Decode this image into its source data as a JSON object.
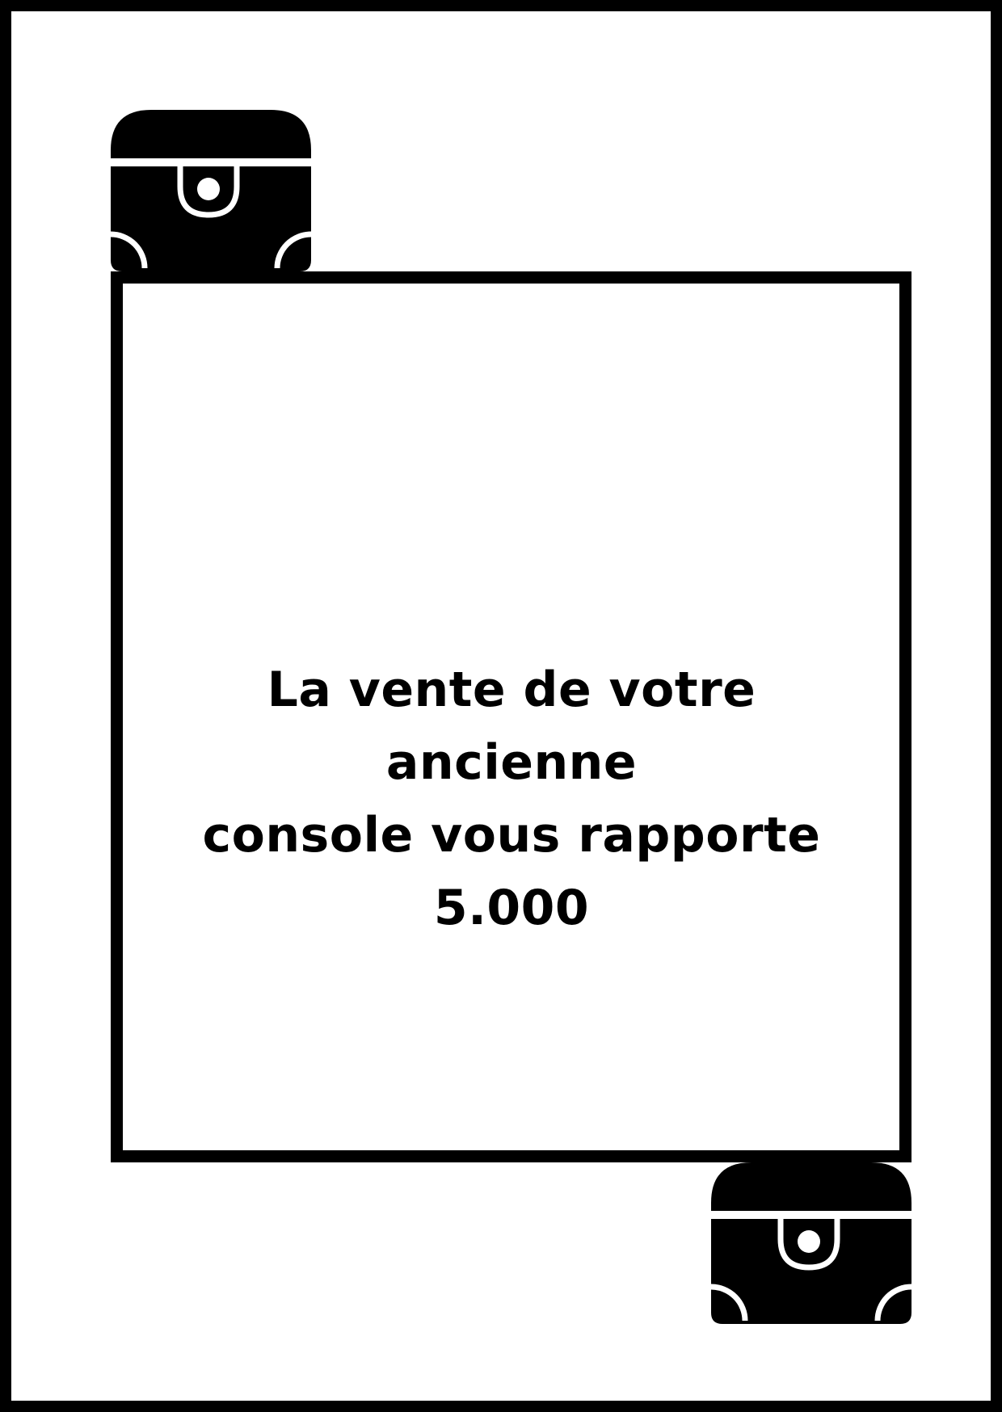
{
  "card": {
    "message_line_1": "La vente de votre ancienne",
    "message_line_2": "console vous rapporte 5.000"
  },
  "icons": {
    "top_left": "treasure-chest-icon",
    "bottom_right": "treasure-chest-icon"
  },
  "colors": {
    "ink": "#000000",
    "paper": "#ffffff"
  }
}
